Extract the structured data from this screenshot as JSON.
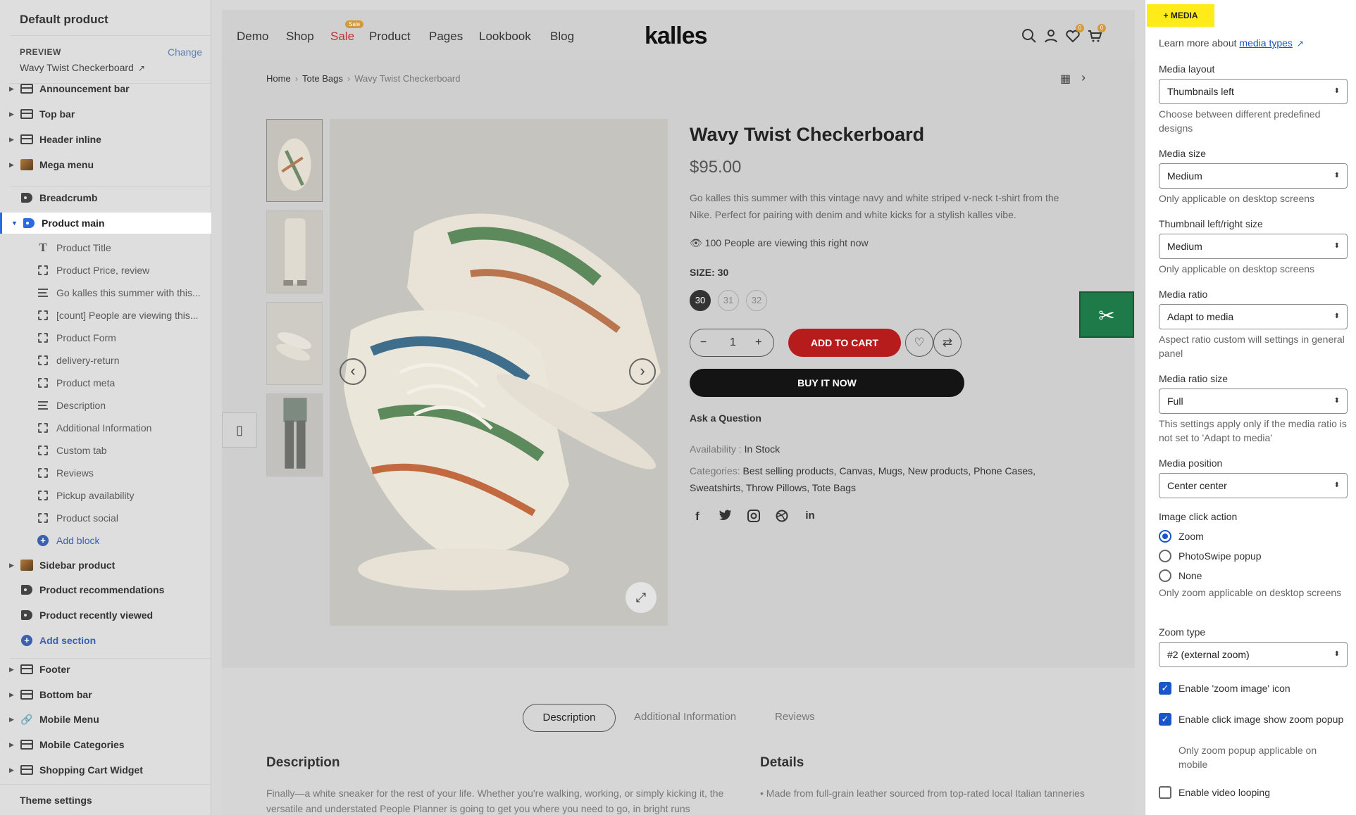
{
  "left": {
    "title": "Default product",
    "preview_label": "PREVIEW",
    "change_label": "Change",
    "preview_value": "Wavy Twist Checkerboard",
    "sections_top": [
      {
        "label": "Announcement bar",
        "icon": "layout-icon"
      },
      {
        "label": "Top bar",
        "icon": "layout-icon"
      },
      {
        "label": "Header inline",
        "icon": "layout-icon"
      },
      {
        "label": "Mega menu",
        "icon": "image-icon"
      },
      {
        "label": "Breadcrumb",
        "icon": "tag-icon"
      },
      {
        "label": "Product main",
        "icon": "tag-icon",
        "active": true
      }
    ],
    "blocks": [
      {
        "label": "Product Title",
        "icon": "text-icon"
      },
      {
        "label": "Product Price, review",
        "icon": "block-icon"
      },
      {
        "label": "Go kalles this summer with this...",
        "icon": "lines-icon"
      },
      {
        "label": "[count] People are viewing this...",
        "icon": "block-icon"
      },
      {
        "label": "Product Form",
        "icon": "block-icon"
      },
      {
        "label": "delivery-return",
        "icon": "block-icon"
      },
      {
        "label": "Product meta",
        "icon": "block-icon"
      },
      {
        "label": "Description",
        "icon": "lines-icon"
      },
      {
        "label": "Additional Information",
        "icon": "block-icon"
      },
      {
        "label": "Custom tab",
        "icon": "block-icon"
      },
      {
        "label": "Reviews",
        "icon": "block-icon"
      },
      {
        "label": "Pickup availability",
        "icon": "block-icon"
      },
      {
        "label": "Product social",
        "icon": "block-icon"
      }
    ],
    "add_block": "Add block",
    "sections_mid": [
      {
        "label": "Sidebar product",
        "icon": "image-icon"
      },
      {
        "label": "Product recommendations",
        "icon": "tag-icon"
      },
      {
        "label": "Product recently viewed",
        "icon": "tag-icon"
      }
    ],
    "add_section": "Add section",
    "sections_bottom": [
      {
        "label": "Footer",
        "icon": "layout-icon"
      },
      {
        "label": "Bottom bar",
        "icon": "layout-icon"
      },
      {
        "label": "Mobile Menu",
        "icon": "link-icon"
      },
      {
        "label": "Mobile Categories",
        "icon": "layout-icon"
      },
      {
        "label": "Shopping Cart Widget",
        "icon": "layout-icon"
      }
    ],
    "theme_settings": "Theme settings"
  },
  "store": {
    "nav": [
      "Demo",
      "Shop",
      "Sale",
      "Product",
      "Pages",
      "Lookbook",
      "Blog"
    ],
    "sale_badge": "Sale",
    "logo": "kalles",
    "wishlist_count": "0",
    "cart_count": "0",
    "breadcrumb": [
      "Home",
      "Tote Bags",
      "Wavy Twist Checkerboard"
    ],
    "product_title": "Wavy Twist Checkerboard",
    "price": "$95.00",
    "description": "Go kalles this summer with this vintage navy and white striped v-neck t-shirt from the Nike. Perfect for pairing with denim and white kicks for a stylish kalles vibe.",
    "viewing": "100 People are viewing this right now",
    "size_label": "SIZE: 30",
    "sizes": [
      "30",
      "31",
      "32"
    ],
    "quantity": "1",
    "add_to_cart": "ADD TO CART",
    "buy_now": "BUY IT NOW",
    "ask_question": "Ask a Question",
    "availability_label": "Availability :",
    "availability_value": "In Stock",
    "categories_label": "Categories:",
    "categories_value": "Best selling products, Canvas, Mugs, New products, Phone Cases, Sweatshirts, Throw Pillows, Tote Bags",
    "tabs": [
      "Description",
      "Additional Information",
      "Reviews"
    ],
    "desc_heading": "Description",
    "details_heading": "Details",
    "desc_text": "Finally—a white sneaker for the rest of your life. Whether you're walking, working, or simply kicking it, the versatile and understated People Planner is going to get you where you need to go, in bright runs",
    "details_text": "Made from full-grain leather sourced from top-rated local Italian tanneries"
  },
  "panel": {
    "header": "+ MEDIA",
    "learn_prefix": "Learn more about",
    "learn_link": "media types",
    "media_layout_label": "Media layout",
    "media_layout_value": "Thumbnails left",
    "media_layout_help": "Choose between different predefined designs",
    "media_size_label": "Media size",
    "media_size_value": "Medium",
    "media_size_help": "Only applicable on desktop screens",
    "thumb_size_label": "Thumbnail left/right size",
    "thumb_size_value": "Medium",
    "thumb_size_help": "Only applicable on desktop screens",
    "ratio_label": "Media ratio",
    "ratio_value": "Adapt to media",
    "ratio_help": "Aspect ratio custom will settings in general panel",
    "ratio_size_label": "Media ratio size",
    "ratio_size_value": "Full",
    "ratio_size_help": "This settings apply only if the media ratio is not set to 'Adapt to media'",
    "position_label": "Media position",
    "position_value": "Center center",
    "click_label": "Image click action",
    "click_options": [
      "Zoom",
      "PhotoSwipe popup",
      "None"
    ],
    "click_selected": "Zoom",
    "click_help": "Only zoom applicable on desktop screens",
    "zoom_type_label": "Zoom type",
    "zoom_type_value": "#2 (external zoom)",
    "cb_zoom_icon": "Enable 'zoom image' icon",
    "cb_zoom_icon_checked": true,
    "cb_click_popup": "Enable click image show zoom popup",
    "cb_click_popup_checked": true,
    "cb_click_popup_help": "Only zoom popup applicable on mobile",
    "cb_video_loop": "Enable video looping",
    "cb_video_loop_checked": false
  },
  "colors": {
    "accent": "#1a56c9",
    "highlight": "#ffeb1a",
    "add_to_cart": "#b71c1c",
    "green_button": "#1f7a4a"
  }
}
